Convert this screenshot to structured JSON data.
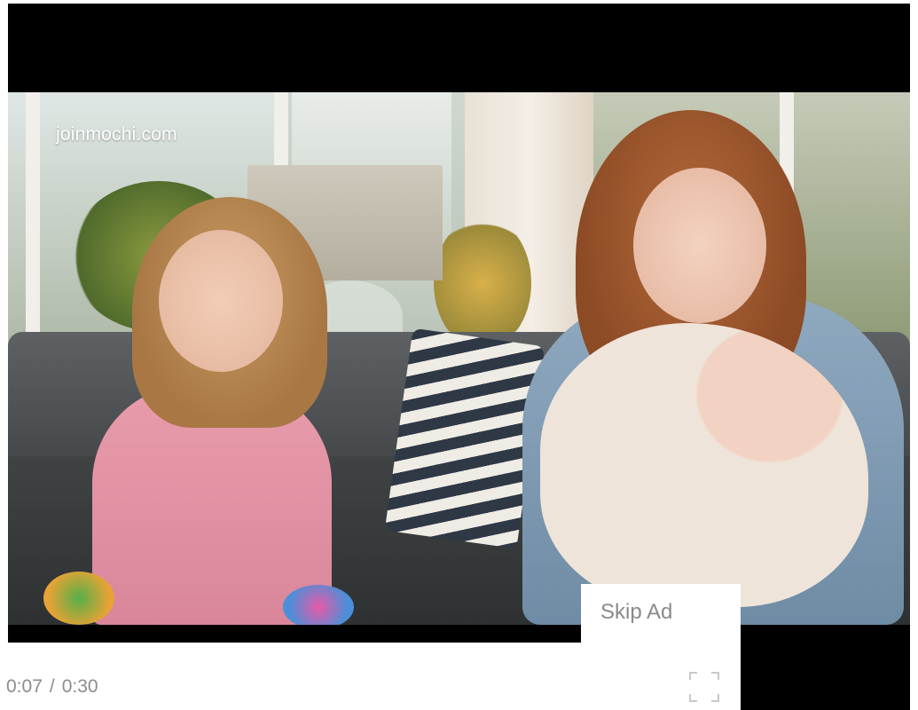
{
  "video": {
    "watermark": "joinmochi.com"
  },
  "ad": {
    "skip_label": "Skip Ad"
  },
  "controls": {
    "current_time": "0:07",
    "separator": "/",
    "duration": "0:30",
    "fullscreen_icon": "fullscreen-icon"
  }
}
